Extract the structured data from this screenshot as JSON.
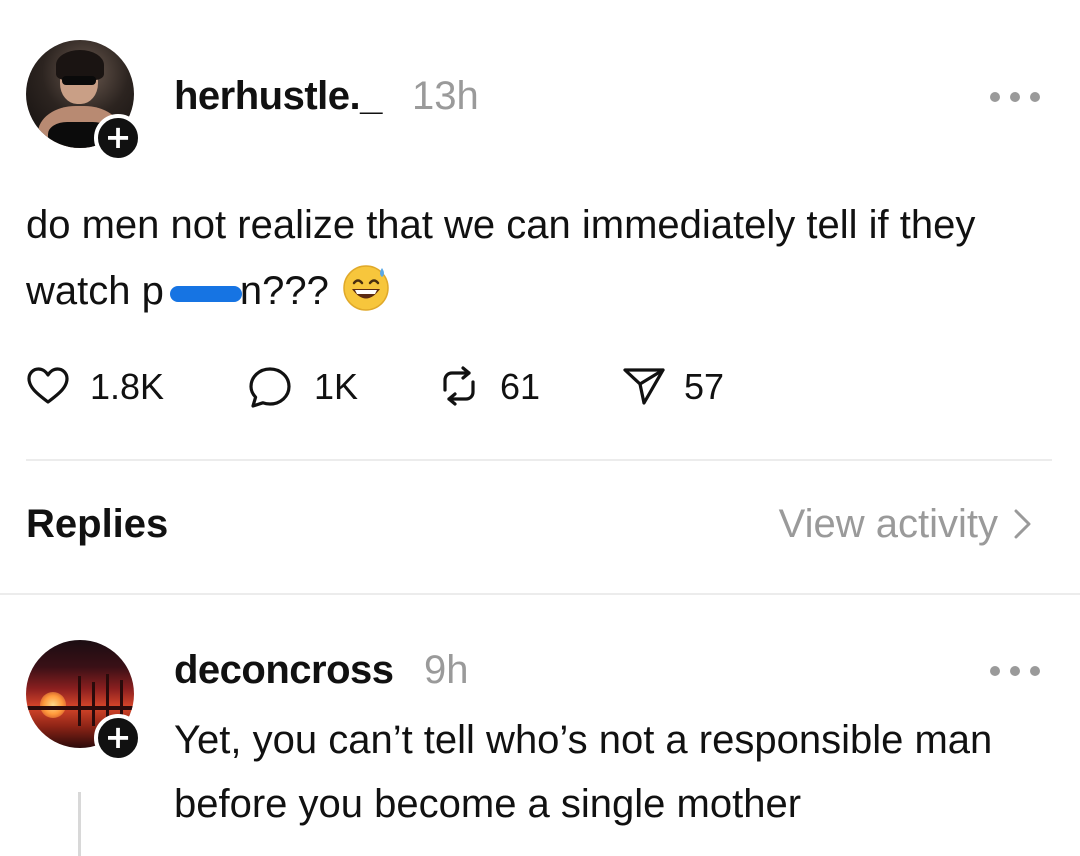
{
  "post": {
    "author": "herhustle._",
    "time": "13h",
    "text_before": "do men not realize that we can immediately tell if they watch p",
    "text_after": "n???",
    "emoji": "grinning-sweat-emoji",
    "stats": {
      "likes": "1.8K",
      "comments": "1K",
      "reposts": "61",
      "shares": "57"
    }
  },
  "replies_section": {
    "label": "Replies",
    "view_activity": "View activity"
  },
  "reply": {
    "author": "deconcross",
    "time": "9h",
    "text": "Yet, you can’t tell who’s not a responsible man before you become a single mother"
  },
  "colors": {
    "text": "#111111",
    "muted": "#9a9a9a",
    "divider": "#ececec",
    "redaction": "#1674e3"
  },
  "icons": {
    "like": "heart-outline-icon",
    "comment": "speech-bubble-icon",
    "repost": "repost-arrows-icon",
    "share": "paper-plane-icon",
    "more": "more-dots-icon",
    "follow": "plus-icon",
    "chevron": "chevron-right-icon"
  }
}
